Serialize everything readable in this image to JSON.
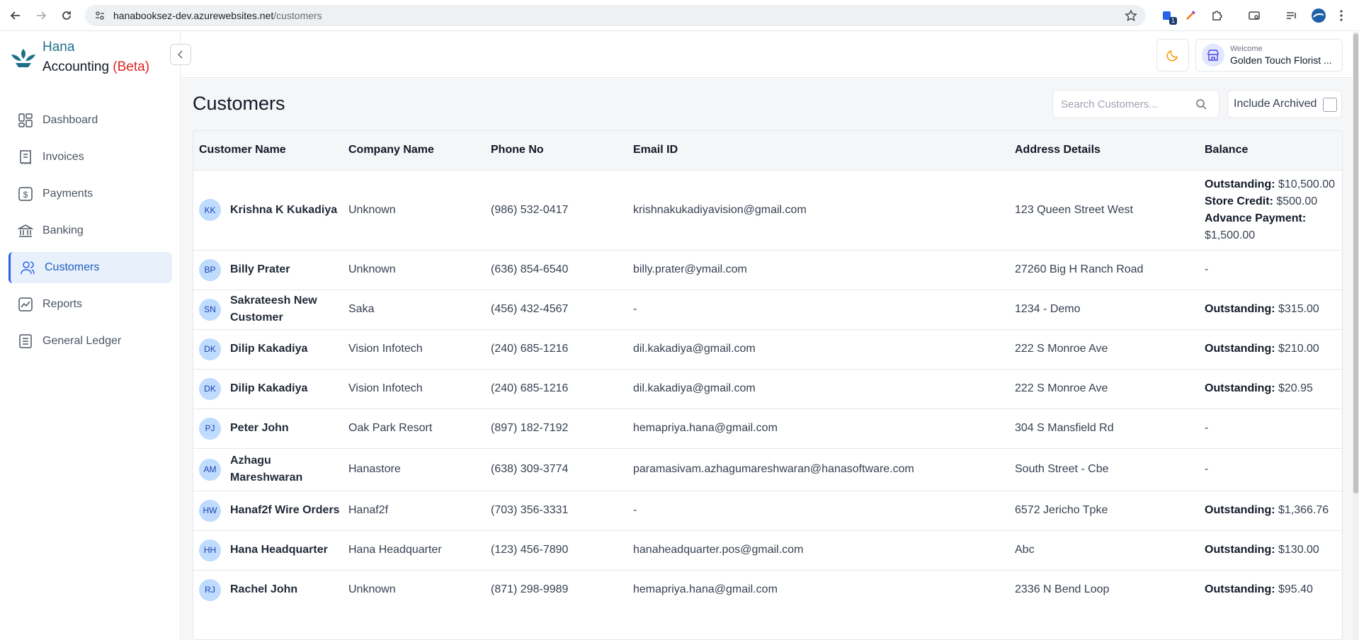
{
  "browser": {
    "url_host": "hanabooksez-dev.azurewebsites.net",
    "url_path": "/customers",
    "extension_badge": "1"
  },
  "brand": {
    "name_top": "Hana",
    "name_bottom": "Accounting",
    "beta": "(Beta)"
  },
  "sidebar": {
    "items": [
      {
        "label": "Dashboard",
        "icon": "dashboard-icon"
      },
      {
        "label": "Invoices",
        "icon": "invoice-icon"
      },
      {
        "label": "Payments",
        "icon": "dollar-icon"
      },
      {
        "label": "Banking",
        "icon": "bank-icon"
      },
      {
        "label": "Customers",
        "icon": "users-icon",
        "active": true
      },
      {
        "label": "Reports",
        "icon": "chart-icon"
      },
      {
        "label": "General Ledger",
        "icon": "ledger-icon"
      }
    ]
  },
  "header": {
    "welcome": "Welcome",
    "user_name": "Golden Touch Florist ..."
  },
  "page": {
    "title": "Customers",
    "search_placeholder": "Search Customers...",
    "include_archived": "Include Archived"
  },
  "table": {
    "columns": [
      "Customer Name",
      "Company Name",
      "Phone No",
      "Email ID",
      "Address Details",
      "Balance"
    ],
    "rows": [
      {
        "initials": "KK",
        "name": "Krishna K Kukadiya",
        "company": "Unknown",
        "phone": "(986) 532-0417",
        "email": "krishnakukadiyavision@gmail.com",
        "address": "123 Queen Street West",
        "balance": [
          {
            "label": "Outstanding:",
            "value": " $10,500.00"
          },
          {
            "label": "Store Credit:",
            "value": " $500.00"
          },
          {
            "label": "Advance Payment:",
            "value": ""
          },
          {
            "label": "",
            "value": "$1,500.00"
          }
        ]
      },
      {
        "initials": "BP",
        "name": "Billy Prater",
        "company": "Unknown",
        "phone": "(636) 854-6540",
        "email": "billy.prater@ymail.com",
        "address": "27260 Big H Ranch Road",
        "balance": [
          {
            "label": "",
            "value": "-"
          }
        ]
      },
      {
        "initials": "SN",
        "name": "Sakrateesh New Customer",
        "company": "Saka",
        "phone": "(456) 432-4567",
        "email": "-",
        "address": "1234 - Demo",
        "balance": [
          {
            "label": "Outstanding:",
            "value": " $315.00"
          }
        ]
      },
      {
        "initials": "DK",
        "name": "Dilip Kakadiya",
        "company": "Vision Infotech",
        "phone": "(240) 685-1216",
        "email": "dil.kakadiya@gmail.com",
        "address": "222 S Monroe Ave",
        "balance": [
          {
            "label": "Outstanding:",
            "value": " $210.00"
          }
        ]
      },
      {
        "initials": "DK",
        "name": "Dilip Kakadiya",
        "company": "Vision Infotech",
        "phone": "(240) 685-1216",
        "email": "dil.kakadiya@gmail.com",
        "address": "222 S Monroe Ave",
        "balance": [
          {
            "label": "Outstanding:",
            "value": " $20.95"
          }
        ]
      },
      {
        "initials": "PJ",
        "name": "Peter John",
        "company": "Oak Park Resort",
        "phone": "(897) 182-7192",
        "email": "hemapriya.hana@gmail.com",
        "address": "304 S Mansfield Rd",
        "balance": [
          {
            "label": "",
            "value": "-"
          }
        ]
      },
      {
        "initials": "AM",
        "name": "Azhagu Mareshwaran",
        "company": "Hanastore",
        "phone": "(638) 309-3774",
        "email": "paramasivam.azhagumareshwaran@hanasoftware.com",
        "address": "South Street - Cbe",
        "balance": [
          {
            "label": "",
            "value": "-"
          }
        ]
      },
      {
        "initials": "HW",
        "name": "Hanaf2f Wire Orders",
        "company": "Hanaf2f",
        "phone": "(703) 356-3331",
        "email": "-",
        "address": "6572 Jericho Tpke",
        "balance": [
          {
            "label": "Outstanding:",
            "value": " $1,366.76"
          }
        ]
      },
      {
        "initials": "HH",
        "name": "Hana Headquarter",
        "company": "Hana Headquarter",
        "phone": "(123) 456-7890",
        "email": "hanaheadquarter.pos@gmail.com",
        "address": "Abc",
        "balance": [
          {
            "label": "Outstanding:",
            "value": " $130.00"
          }
        ]
      },
      {
        "initials": "RJ",
        "name": "Rachel John",
        "company": "Unknown",
        "phone": "(871) 298-9989",
        "email": "hemapriya.hana@gmail.com",
        "address": "2336 N Bend Loop",
        "balance": [
          {
            "label": "Outstanding:",
            "value": " $95.40"
          }
        ]
      }
    ]
  }
}
